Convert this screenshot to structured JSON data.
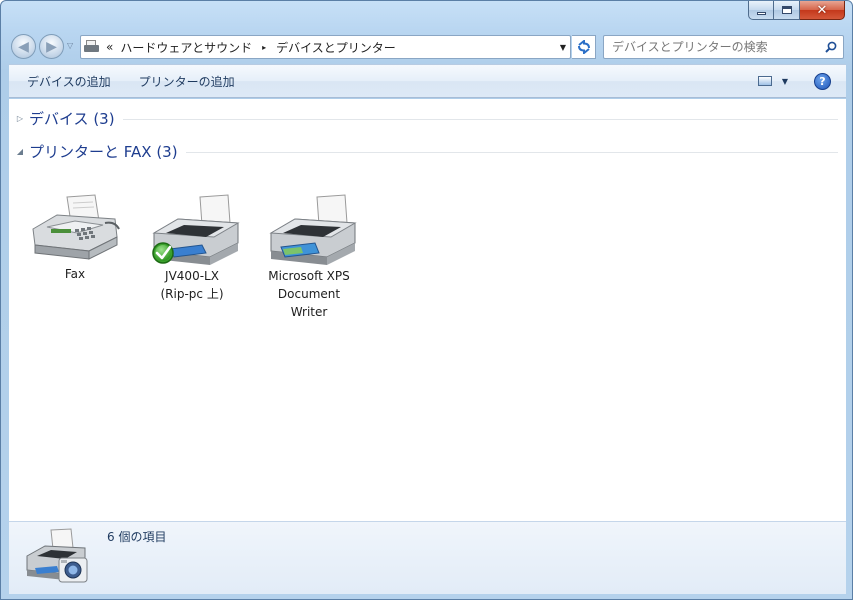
{
  "window": {
    "caption_minimize": "minimize",
    "caption_maximize": "maximize",
    "caption_close": "✕"
  },
  "address": {
    "overflow_glyph": "«",
    "crumbs": [
      "ハードウェアとサウンド",
      "デバイスとプリンター"
    ],
    "separator_glyph": "▸"
  },
  "search": {
    "placeholder": "デバイスとプリンターの検索"
  },
  "toolbar": {
    "add_device": "デバイスの追加",
    "add_printer": "プリンターの追加"
  },
  "groups": [
    {
      "title": "デバイス (3)",
      "expanded": false
    },
    {
      "title": "プリンターと FAX (3)",
      "expanded": true
    }
  ],
  "devices": [
    {
      "label_lines": [
        "Fax"
      ],
      "icon": "fax-icon"
    },
    {
      "label_lines": [
        "JV400-LX",
        "(Rip-pc 上)"
      ],
      "icon": "printer-icon",
      "default": true
    },
    {
      "label_lines": [
        "Microsoft XPS",
        "Document",
        "Writer"
      ],
      "icon": "printer-icon"
    }
  ],
  "status": {
    "text": "6 個の項目"
  },
  "colors": {
    "link_blue": "#1e3d8f",
    "frame_blue": "#b9d6f1",
    "close_red": "#c4381b",
    "check_green": "#3aa12c"
  }
}
